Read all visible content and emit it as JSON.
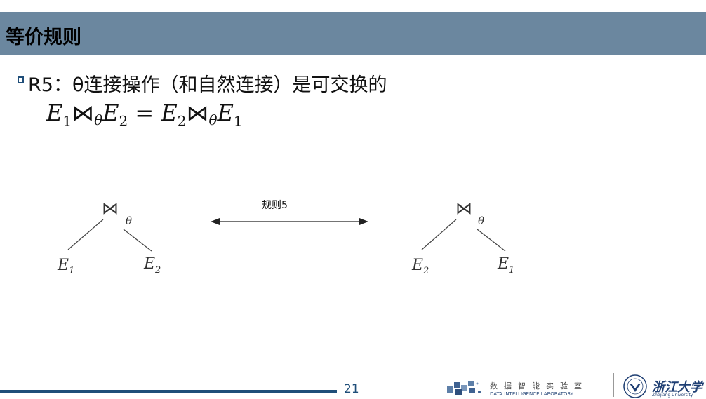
{
  "header": {
    "title": "等价规则"
  },
  "bullet": {
    "text": "R5：θ连接操作（和自然连接）是可交换的"
  },
  "formula": {
    "lhs_e1": "E",
    "lhs_e1_sub": "1",
    "join": "⋈",
    "theta": "θ",
    "lhs_e2": "E",
    "lhs_e2_sub": "2",
    "eq": "=",
    "rhs_e2": "E",
    "rhs_e2_sub": "2",
    "rhs_e1": "E",
    "rhs_e1_sub": "1"
  },
  "diagram": {
    "left_tree": {
      "root": "⋈",
      "condition": "θ",
      "left_leaf": "E",
      "left_leaf_sub": "1",
      "right_leaf": "E",
      "right_leaf_sub": "2"
    },
    "arrow_label": "规则5",
    "right_tree": {
      "root": "⋈",
      "condition": "θ",
      "left_leaf": "E",
      "left_leaf_sub": "2",
      "right_leaf": "E",
      "right_leaf_sub": "1"
    }
  },
  "footer": {
    "page_number": "21",
    "lab_name_cn": "数据智能实验室",
    "lab_name_en": "DATA INTELLIGENCE LABORATORY",
    "university_cn": "浙江大学",
    "university_en": "Zhejiang University"
  },
  "colors": {
    "title_bar": "#6b879f",
    "accent": "#1f4e79"
  }
}
